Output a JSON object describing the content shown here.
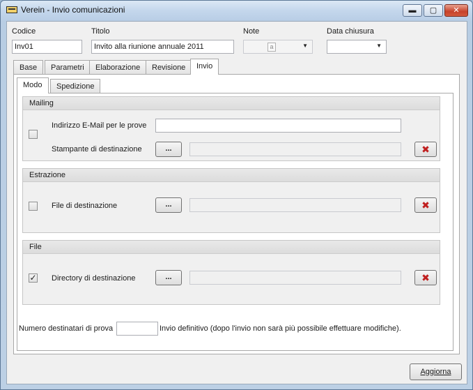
{
  "window": {
    "title": "Verein - Invio comunicazioni",
    "min_glyph": "▬",
    "max_glyph": "▢",
    "close_glyph": "✕"
  },
  "header": {
    "codice_label": "Codice",
    "codice_value": "Inv01",
    "titolo_label": "Titolo",
    "titolo_value": "Invito alla riunione annuale 2011",
    "note_label": "Note",
    "note_icon": "a",
    "data_chiusura_label": "Data chiusura",
    "dropdown_glyph": "▼"
  },
  "tabs": [
    {
      "label": "Base"
    },
    {
      "label": "Parametri"
    },
    {
      "label": "Elaborazione"
    },
    {
      "label": "Revisione"
    },
    {
      "label": "Invio"
    }
  ],
  "subtabs": [
    {
      "label": "Modo"
    },
    {
      "label": "Spedizione"
    }
  ],
  "mailing": {
    "title": "Mailing",
    "checked": false,
    "email_label": "Indirizzo E-Mail per le prove",
    "email_value": "",
    "printer_label": "Stampante di destinazione",
    "browse_label": "...",
    "clear_glyph": "✖"
  },
  "estrazione": {
    "title": "Estrazione",
    "checked": false,
    "file_label": "File di destinazione",
    "browse_label": "...",
    "clear_glyph": "✖"
  },
  "file": {
    "title": "File",
    "checked": true,
    "check_glyph": "✓",
    "dir_label": "Directory di destinazione",
    "browse_label": "...",
    "clear_glyph": "✖"
  },
  "footer": {
    "numero_label": "Numero destinatari di prova",
    "numero_value": "",
    "invio_label": "Invio definitivo (dopo l'invio non sarà più possibile effettuare modifiche).",
    "aggiorna_label": "Aggiorna"
  },
  "colors": {
    "close_red": "#c7422a",
    "clear_red": "#c01f1f"
  },
  "icons": {
    "app": "app-icon",
    "minimize": "minimize-icon",
    "maximize": "maximize-icon",
    "close": "close-icon",
    "note": "note-icon",
    "clear": "red-x-icon",
    "dropdown": "chevron-down-icon",
    "check": "check-icon"
  }
}
